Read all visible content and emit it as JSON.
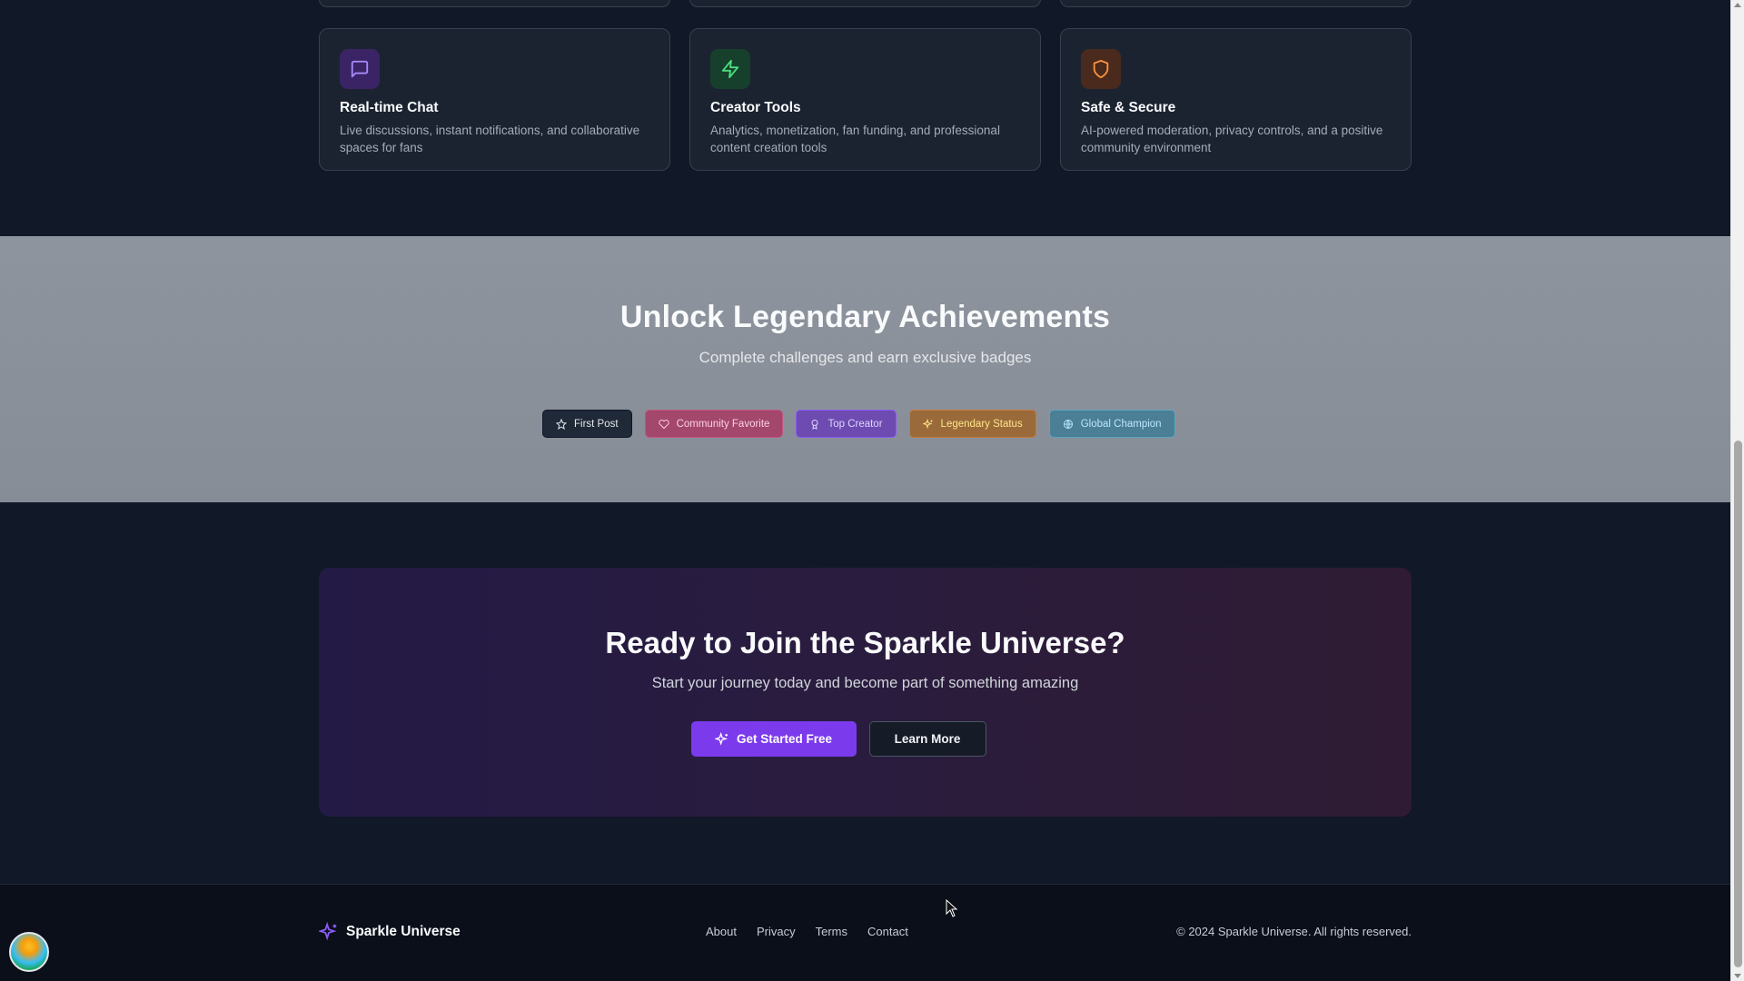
{
  "features": {
    "cards": [
      {
        "title": "Real-time Chat",
        "desc": "Live discussions, instant notifications, and collaborative spaces for fans",
        "icon": "chat-bubble-icon",
        "color": "#a78bfa",
        "bg": "#3b2466"
      },
      {
        "title": "Creator Tools",
        "desc": "Analytics, monetization, fan funding, and professional content creation tools",
        "icon": "lightning-icon",
        "color": "#4ade80",
        "bg": "#16402b"
      },
      {
        "title": "Safe & Secure",
        "desc": "AI-powered moderation, privacy controls, and a positive community environment",
        "icon": "shield-icon",
        "color": "#fb923c",
        "bg": "#4a2a1c"
      }
    ]
  },
  "achievements": {
    "title": "Unlock Legendary Achievements",
    "subtitle": "Complete challenges and earn exclusive badges",
    "badges": [
      {
        "label": "First Post",
        "icon": "star-icon",
        "color": "#e5e7eb",
        "bg": "#1f2937",
        "border": "#111827"
      },
      {
        "label": "Community Favorite",
        "icon": "heart-icon",
        "color": "#fbcfe8",
        "bg": "#a3476c",
        "border": "#c2577f"
      },
      {
        "label": "Top Creator",
        "icon": "trophy-icon",
        "color": "#ddd6fe",
        "bg": "#6d4bb0",
        "border": "#8b5cf6"
      },
      {
        "label": "Legendary Status",
        "icon": "sparkle-icon",
        "color": "#fde68a",
        "bg": "#9a6a3a",
        "border": "#c27c3a"
      },
      {
        "label": "Global Champion",
        "icon": "globe-icon",
        "color": "#bae6fd",
        "bg": "#4b7f95",
        "border": "#5fa5c0"
      }
    ]
  },
  "cta": {
    "title": "Ready to Join the Sparkle Universe?",
    "subtitle": "Start your journey today and become part of something amazing",
    "primary_label": "Get Started Free",
    "secondary_label": "Learn More"
  },
  "footer": {
    "brand": "Sparkle Universe",
    "links": [
      "About",
      "Privacy",
      "Terms",
      "Contact"
    ],
    "copyright": "© 2024 Sparkle Universe. All rights reserved."
  }
}
